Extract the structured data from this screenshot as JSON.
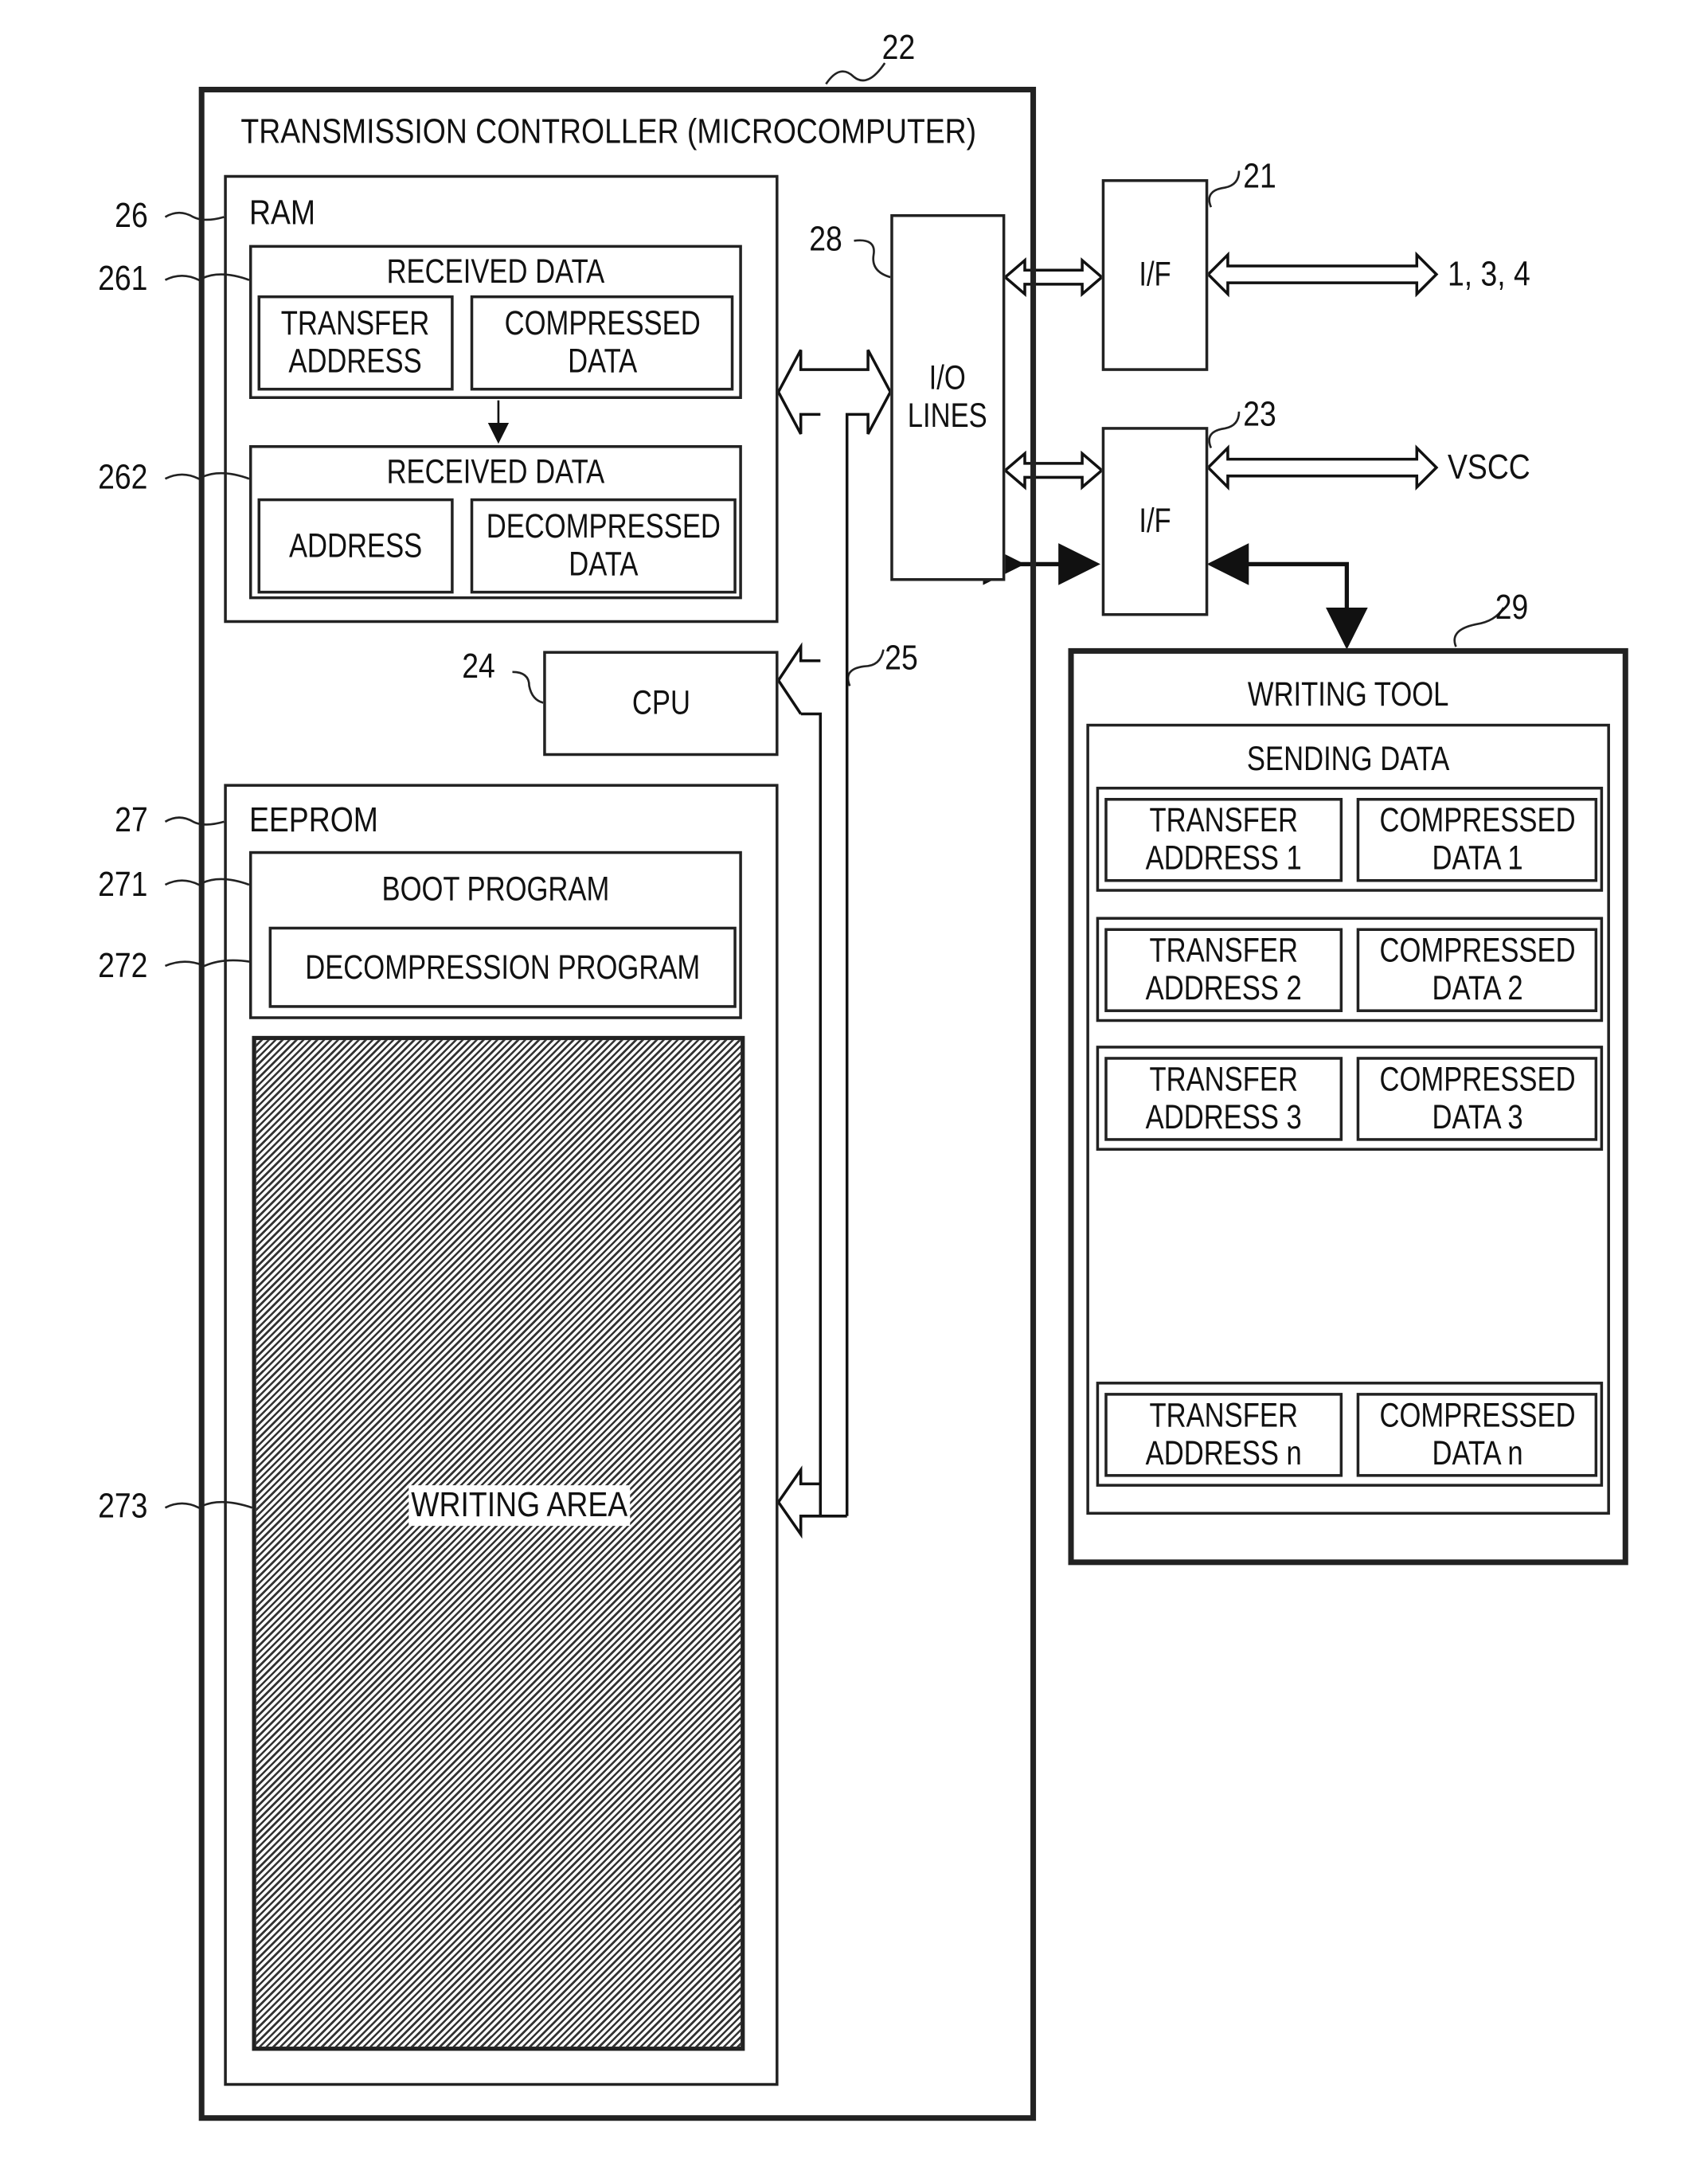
{
  "figure": {
    "controller": {
      "ref": "22",
      "title": "TRANSMISSION CONTROLLER (MICROCOMPUTER)"
    },
    "ram": {
      "ref": "26",
      "label": "RAM",
      "received_before": {
        "ref": "261",
        "title": "RECEIVED DATA",
        "cells": [
          "TRANSFER\nADDRESS",
          "COMPRESSED\nDATA"
        ]
      },
      "received_after": {
        "ref": "262",
        "title": "RECEIVED DATA",
        "cells": [
          "ADDRESS",
          "DECOMPRESSED\nDATA"
        ]
      }
    },
    "cpu": {
      "ref": "24",
      "label": "CPU"
    },
    "bus": {
      "ref": "25"
    },
    "eeprom": {
      "ref": "27",
      "label": "EEPROM",
      "boot": {
        "ref": "271",
        "label": "BOOT PROGRAM"
      },
      "decompression": {
        "ref": "272",
        "label": "DECOMPRESSION PROGRAM"
      },
      "writing_area": {
        "ref": "273",
        "label": "WRITING AREA"
      }
    },
    "io_lines": {
      "ref": "28",
      "label": "I/O\nLINES"
    },
    "if1": {
      "ref": "21",
      "label": "I/F",
      "target": "1, 3, 4"
    },
    "if2": {
      "ref": "23",
      "label": "I/F",
      "target": "VSCC"
    },
    "writing_tool": {
      "ref": "29",
      "label": "WRITING TOOL",
      "sending_data": {
        "title": "SENDING DATA",
        "rows": [
          {
            "address": "TRANSFER\nADDRESS 1",
            "data": "COMPRESSED\nDATA 1"
          },
          {
            "address": "TRANSFER\nADDRESS 2",
            "data": "COMPRESSED\nDATA 2"
          },
          {
            "address": "TRANSFER\nADDRESS 3",
            "data": "COMPRESSED\nDATA 3"
          },
          {
            "address": "TRANSFER\nADDRESS n",
            "data": "COMPRESSED\nDATA n"
          }
        ]
      }
    }
  }
}
